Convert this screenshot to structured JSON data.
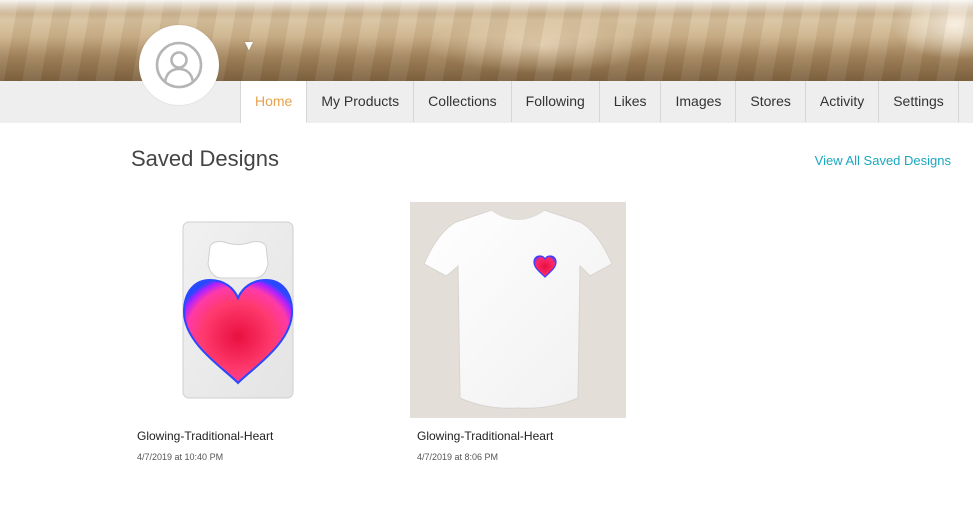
{
  "header": {
    "avatar_icon": "user-silhouette-icon",
    "dropdown_icon": "caret-down-icon",
    "dropdown_glyph": "▼"
  },
  "nav": {
    "tabs": [
      {
        "label": "Home",
        "active": true
      },
      {
        "label": "My Products"
      },
      {
        "label": "Collections"
      },
      {
        "label": "Following"
      },
      {
        "label": "Likes"
      },
      {
        "label": "Images"
      },
      {
        "label": "Stores"
      },
      {
        "label": "Activity"
      },
      {
        "label": "Settings"
      }
    ]
  },
  "saved_designs": {
    "title": "Saved Designs",
    "view_all_label": "View All Saved Designs",
    "items": [
      {
        "name": "Glowing-Traditional-Heart",
        "date": "4/7/2019 at 10:40 PM",
        "product": "credit-card-bottle-opener"
      },
      {
        "name": "Glowing-Traditional-Heart",
        "date": "4/7/2019 at 8:06 PM",
        "product": "white-t-shirt"
      }
    ]
  },
  "colors": {
    "accent_active_tab": "#e8a14d",
    "link": "#1ba7c0",
    "nav_bg": "#eeeeee"
  }
}
